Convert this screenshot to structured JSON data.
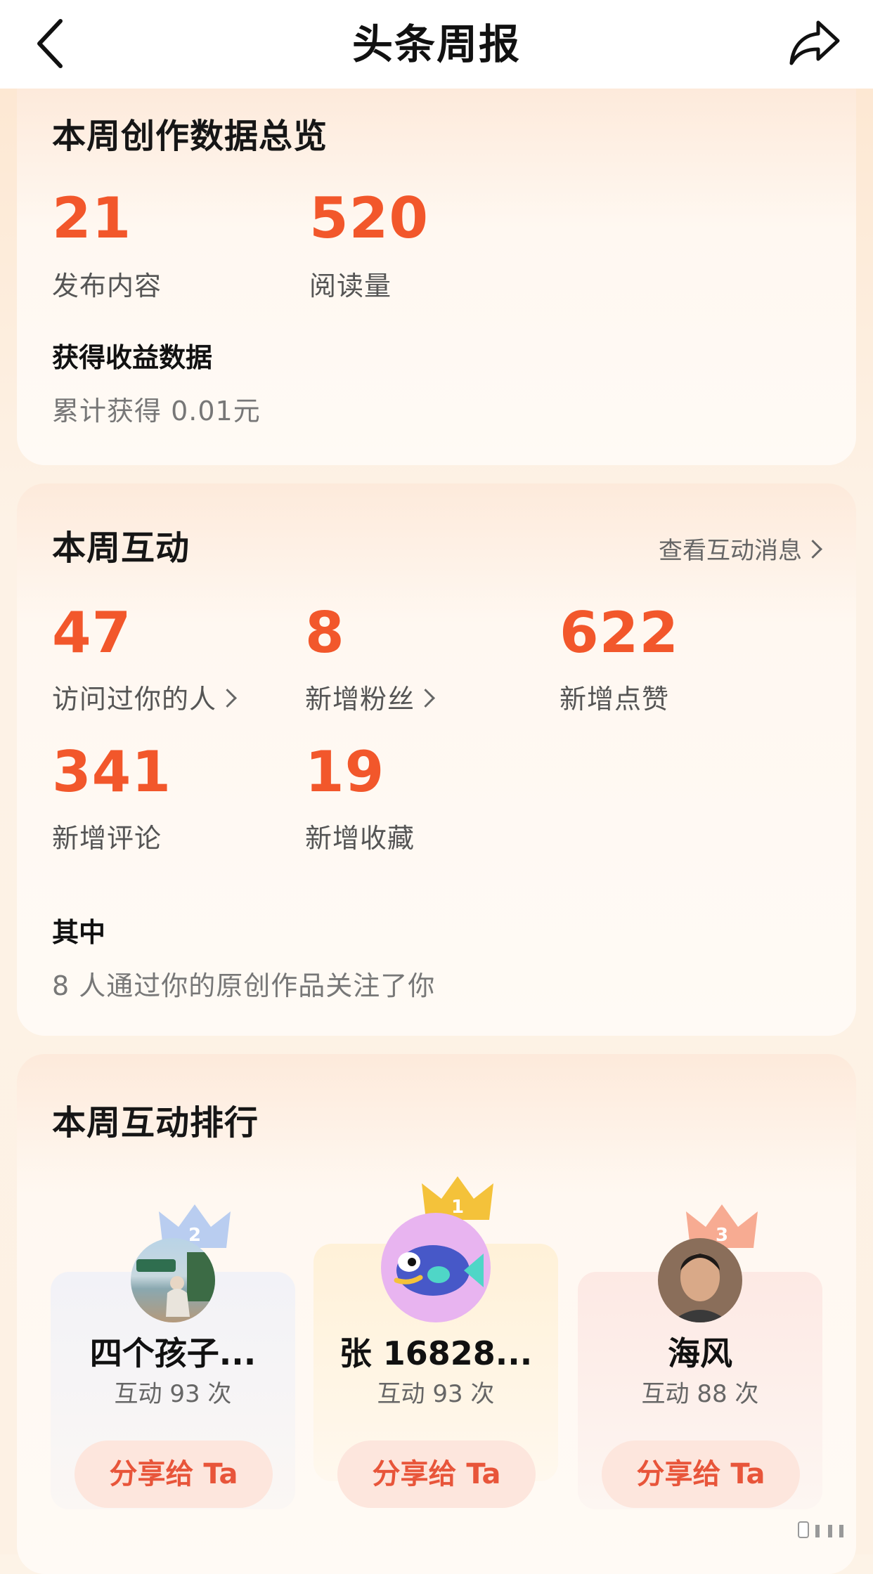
{
  "nav": {
    "title": "头条周报"
  },
  "overview": {
    "title": "本周创作数据总览",
    "stats": [
      {
        "value": "21",
        "label": "发布内容"
      },
      {
        "value": "520",
        "label": "阅读量"
      }
    ],
    "earnings_heading": "获得收益数据",
    "earnings_text": "累计获得 0.01元"
  },
  "interaction": {
    "title": "本周互动",
    "view_link": "查看互动消息",
    "stats": [
      {
        "value": "47",
        "label": "访问过你的人"
      },
      {
        "value": "8",
        "label": "新增粉丝"
      },
      {
        "value": "622",
        "label": "新增点赞"
      },
      {
        "value": "341",
        "label": "新增评论"
      },
      {
        "value": "19",
        "label": "新增收藏"
      }
    ],
    "detail_heading": "其中",
    "detail_text": "8 人通过你的原创作品关注了你"
  },
  "ranking": {
    "title": "本周互动排行",
    "users": [
      {
        "rank": "2",
        "name": "四个孩子...",
        "count": "互动 93 次",
        "share": "分享给 Ta"
      },
      {
        "rank": "1",
        "name": "张 16828...",
        "count": "互动 93 次",
        "share": "分享给 Ta"
      },
      {
        "rank": "3",
        "name": "海风",
        "count": "互动 88 次",
        "share": "分享给 Ta"
      }
    ]
  },
  "colors": {
    "accent": "#f2572b",
    "share_text": "#e8553a",
    "share_bg": "#fde6dd"
  }
}
